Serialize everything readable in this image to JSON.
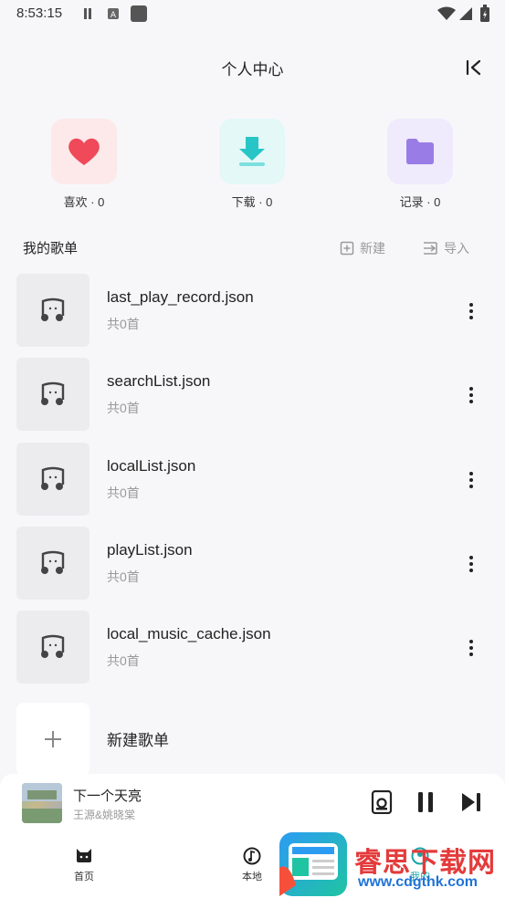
{
  "status_bar": {
    "time": "8:53:15"
  },
  "header": {
    "title": "个人中心"
  },
  "quick": [
    {
      "label": "喜欢 · 0",
      "icon": "heart-icon",
      "bg": "#fde9ea",
      "color": "#f0495a"
    },
    {
      "label": "下载 · 0",
      "icon": "download-icon",
      "bg": "#e4f8f8",
      "color": "#27c5c5"
    },
    {
      "label": "记录 · 0",
      "icon": "folder-icon",
      "bg": "#efeafc",
      "color": "#9a7ce6"
    }
  ],
  "section": {
    "title": "我的歌单",
    "new_label": "新建",
    "import_label": "导入"
  },
  "playlists": [
    {
      "name": "last_play_record.json",
      "count": "共0首"
    },
    {
      "name": "searchList.json",
      "count": "共0首"
    },
    {
      "name": "localList.json",
      "count": "共0首"
    },
    {
      "name": "playList.json",
      "count": "共0首"
    },
    {
      "name": "local_music_cache.json",
      "count": "共0首"
    }
  ],
  "new_playlist": {
    "label": "新建歌单"
  },
  "player": {
    "song": "下一个天亮",
    "artist": "王源&姚晓棠"
  },
  "nav": [
    {
      "label": "首页",
      "icon": "cat-icon"
    },
    {
      "label": "本地",
      "icon": "music-note-icon"
    },
    {
      "label": "我的",
      "icon": "user-icon"
    }
  ],
  "watermark": {
    "text": "睿思下载网",
    "url": "www.cdgthk.com"
  }
}
